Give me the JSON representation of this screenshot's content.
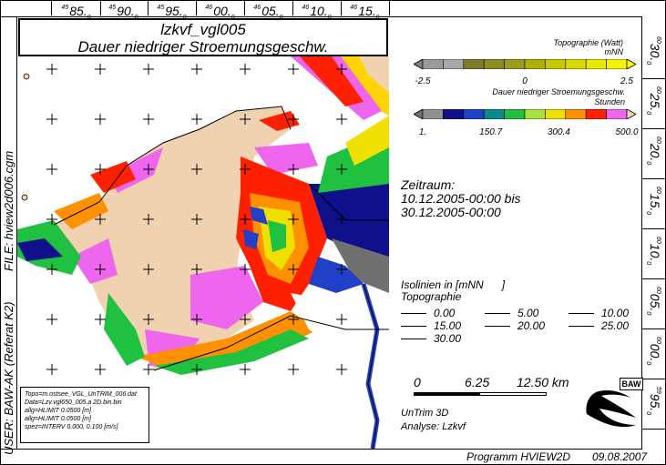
{
  "top_axis": [
    {
      "sup": "45",
      "main": "85.",
      "sub": "0"
    },
    {
      "sup": "45",
      "main": "90.",
      "sub": "0"
    },
    {
      "sup": "45",
      "main": "95.",
      "sub": "0"
    },
    {
      "sup": "46",
      "main": "00.",
      "sub": "0"
    },
    {
      "sup": "46",
      "main": "05.",
      "sub": "0"
    },
    {
      "sup": "46",
      "main": "10.",
      "sub": "0"
    },
    {
      "sup": "46",
      "main": "15.",
      "sub": "0"
    }
  ],
  "right_axis": [
    {
      "sup": "60",
      "main": "30.",
      "sub": "0"
    },
    {
      "sup": "60",
      "main": "25.",
      "sub": "0"
    },
    {
      "sup": "60",
      "main": "20.",
      "sub": "0"
    },
    {
      "sup": "60",
      "main": "15.",
      "sub": "0"
    },
    {
      "sup": "60",
      "main": "10.",
      "sub": "0"
    },
    {
      "sup": "60",
      "main": "05.",
      "sub": "0"
    },
    {
      "sup": "60",
      "main": "00.",
      "sub": "0"
    },
    {
      "sup": "59",
      "main": "95.",
      "sub": "0"
    }
  ],
  "title": {
    "line1": "lzkvf_vgl005",
    "line2": "Dauer niedriger Stroemungsgeschw."
  },
  "side_label_file": "FILE: hview2d006.cgm",
  "side_label_user": "USER: BAW-AK (Referat K2)",
  "legend_topo": {
    "title": "Topographie (Watt)",
    "unit": "mNN",
    "ticks": [
      "-2.5",
      "0",
      "2.5"
    ],
    "colors": [
      "#808080",
      "#9a9a9a",
      "#a8a8a8",
      "#7c7c2a",
      "#8c8c22",
      "#9c9c1c",
      "#b0b000",
      "#c8c800",
      "#dada00",
      "#e8e800",
      "#f4f400",
      "#ffff00"
    ]
  },
  "legend_duration": {
    "title": "Dauer niedriger Stroemungsgeschw.",
    "unit": "Stunden",
    "ticks": [
      "1.",
      "150.7",
      "300.4",
      "500.0"
    ],
    "colors": [
      "#707070",
      "#909090",
      "#10108a",
      "#2040c8",
      "#0a8a8a",
      "#20c040",
      "#a8e040",
      "#f0e000",
      "#ff9000",
      "#ff2000",
      "#ee66ee",
      "#f0d2b0"
    ]
  },
  "period": {
    "label": "Zeitraum:",
    "from": "10.12.2005-00:00 bis",
    "to": "30.12.2005-00:00"
  },
  "isolines": {
    "heading": "Isolinien in [mNN      ]",
    "sub": "Topographie",
    "values": [
      "0.00",
      "5.00",
      "10.00",
      "15.00",
      "20.00",
      "25.00",
      "30.00"
    ]
  },
  "scale": {
    "ticks": [
      "0",
      "6.25",
      "12.50 km"
    ]
  },
  "model": {
    "line1": "UnTrim 3D",
    "line2": "Analyse: Lzkvf"
  },
  "logo_text": "BAW",
  "info_box": [
    "Topo=m.ostsee_VGL_UnTRIM_006.dat",
    "Data=Lzv.vgl650_005.a 2D.bin.bin",
    "allg=HLIMIT   0.0500 [m]",
    "allg=HLIMIT   0.0500 [m]",
    "spez=INTERV   0.000,    0.100 [m/s]"
  ],
  "footer": {
    "program": "Programm HVIEW2D",
    "date": "09.08.2007"
  }
}
